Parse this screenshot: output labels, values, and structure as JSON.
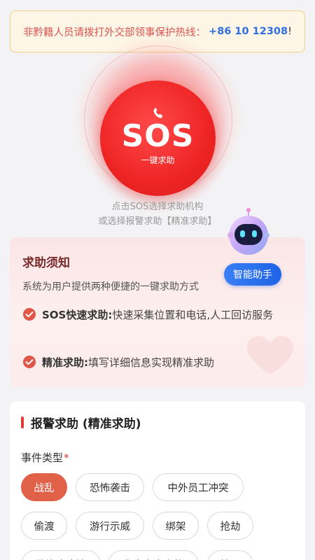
{
  "notice": {
    "text": "非黔籍人员请拨打外交部领事保护热线：",
    "phone": "+86 10 12308",
    "suffix": "!"
  },
  "sos": {
    "label": "SOS",
    "sublabel": "一键求助",
    "icon": "phone-icon"
  },
  "hint": {
    "line1": "点击SOS选择求助机构",
    "line2": "或选择报警求助【精准求助】"
  },
  "guide": {
    "title": "求助须知",
    "desc": "系统为用户提供两种便捷的一键求助方式",
    "items": [
      {
        "title": "SOS快速求助:",
        "text": "快速采集位置和电话,人工回访服务"
      },
      {
        "title": "精准求助:",
        "text": "填写详细信息实现精准求助"
      }
    ]
  },
  "assistant": {
    "label": "智能助手",
    "icon": "robot-icon"
  },
  "form": {
    "title": "报警求助 (精准求助)",
    "field_label": "事件类型",
    "required_mark": "*",
    "event_types": [
      "战乱",
      "恐怖袭击",
      "中外员工冲突",
      "偷渡",
      "游行示威",
      "绑架",
      "抢劫",
      "传染病疫情",
      "生产安全事故",
      "地震"
    ],
    "selected": "战乱"
  },
  "colors": {
    "accent_red": "#ee2424",
    "chip_active": "#e06148",
    "assistant_blue": "#1e63e6",
    "notice_border": "#f1cf88"
  }
}
